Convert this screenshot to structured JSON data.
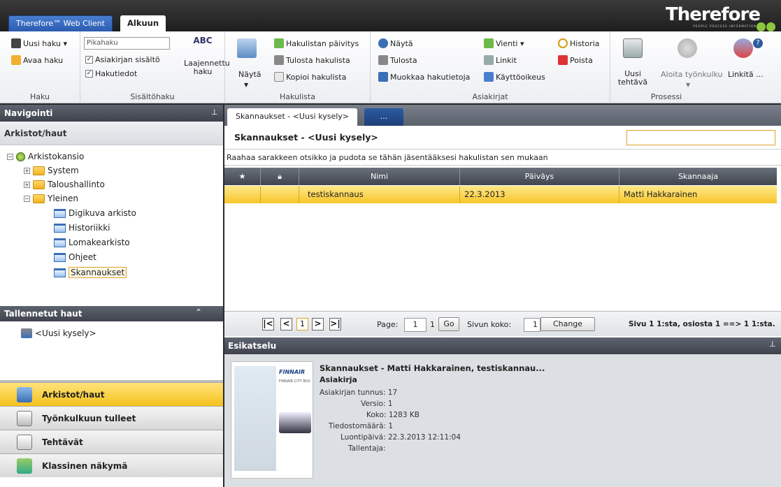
{
  "topbar": {
    "client_tab": "Therefore™ Web Client",
    "home_tab": "Alkuun",
    "logo": "Therefore",
    "logo_sub": "PEOPLE PROCESS INFORMATION"
  },
  "ribbon": {
    "haku": {
      "new_search": "Uusi haku ▾",
      "open_search": "Avaa haku",
      "label": "Haku"
    },
    "sisaltohaku": {
      "placeholder": "Pikahaku",
      "opt1": "Asiakirjan sisältö",
      "opt2": "Hakutiedot",
      "advanced": "Laajennettu haku",
      "label": "Sisältöhaku"
    },
    "hakulista": {
      "show": "Näytä",
      "refresh": "Hakulistan päivitys",
      "print": "Tulosta hakulista",
      "copy": "Kopioi hakulista",
      "label": "Hakulista"
    },
    "asiakirjat": {
      "view": "Näytä",
      "print": "Tulosta",
      "edit": "Muokkaa hakutietoja",
      "export": "Vienti ▾",
      "links": "Linkit",
      "rights": "Käyttöoikeus",
      "history": "Historia",
      "delete": "Poista",
      "label": "Asiakirjat"
    },
    "prosessi": {
      "new_task": "Uusi tehtävä",
      "start_wf": "Aloita työnkulku",
      "link": "Linkitä ...",
      "label": "Prosessi"
    }
  },
  "nav": {
    "title": "Navigointi",
    "archives_header": "Arkistot/haut",
    "tree": {
      "root": "Arkistokansio",
      "system": "System",
      "finance": "Taloushallinto",
      "general": "Yleinen",
      "items": [
        "Digikuva arkisto",
        "Historiikki",
        "Lomakearkisto",
        "Ohjeet",
        "Skannaukset"
      ]
    },
    "saved_header": "Tallennetut haut",
    "saved_item": "<Uusi kysely>",
    "buttons": [
      "Arkistot/haut",
      "Työnkulkuun tulleet",
      "Tehtävät",
      "Klassinen näkymä"
    ]
  },
  "main": {
    "tab1": "Skannaukset - <Uusi kysely>",
    "tab2": "...",
    "title": "Skannaukset - <Uusi kysely>",
    "group_hint": "Raahaa sarakkeen otsikko ja pudota se tähän jäsentääksesi hakulistan sen mukaan",
    "columns": [
      "Nimi",
      "Päiväys",
      "Skannaaja"
    ],
    "row": {
      "name": "testiskannaus",
      "date": "22.3.2013",
      "scanner": "Matti Hakkarainen"
    },
    "pager": {
      "page_label": "Page:",
      "page_value": "1",
      "page_total": "1",
      "go": "Go",
      "size_label": "Sivun koko:",
      "size_value": "1",
      "change": "Change",
      "status": "Sivu 1 1:sta, osiosta 1 ==> 1 1:sta.",
      "current": "1"
    }
  },
  "preview": {
    "header": "Esikatselu",
    "title": "Skannaukset - Matti Hakkarainen, testiskannau...",
    "type": "Asiakirja",
    "fields": [
      [
        "Asiakirjan tunnus:",
        "17"
      ],
      [
        "Versio:",
        "1"
      ],
      [
        "Koko:",
        "1283 KB"
      ],
      [
        "Tiedostomäärä:",
        "1"
      ],
      [
        "Luontipäivä:",
        "22.3.2013 12:11:04"
      ],
      [
        "Tallentaja:",
        ""
      ]
    ],
    "thumb_brand": "FINNAIR",
    "thumb_sub": "FINNAIR CITY BUS"
  }
}
